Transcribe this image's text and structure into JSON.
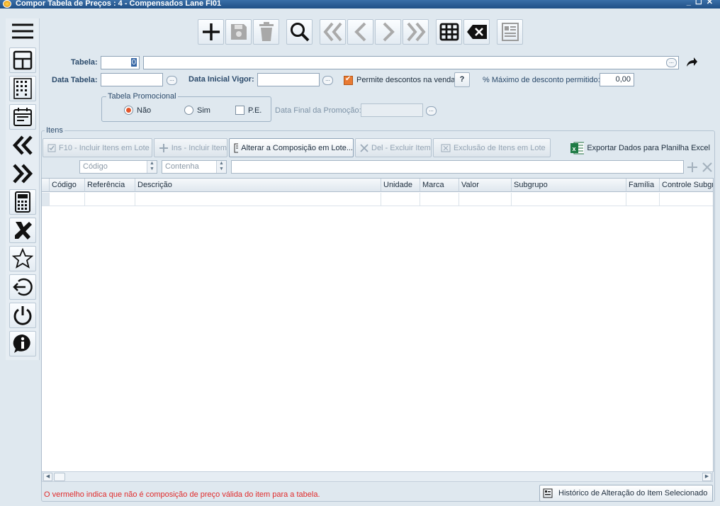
{
  "window": {
    "title": "Compor Tabela de Preços : 4 - Compensados Lane FI01",
    "min": "_",
    "max": "☐",
    "close": "✕"
  },
  "form": {
    "tabela_label": "Tabela:",
    "tabela_value": "0",
    "data_tabela_label": "Data Tabela:",
    "data_inicial_label": "Data Inicial Vigor:",
    "permite_label": "Permite descontos na venda",
    "help_label": "?",
    "max_desc_label": "% Máximo de desconto permitido:",
    "max_desc_value": "0,00",
    "promo_legend": "Tabela Promocional",
    "opt_nao": "Não",
    "opt_sim": "Sim",
    "opt_pe": "P.E.",
    "data_final_label": "Data Final da Promoção:",
    "ell": "..."
  },
  "itens": {
    "legend": "Itens",
    "btn_incluir_lote": "F10 - Incluir Itens em Lote",
    "btn_incluir": "Ins - Incluir Item",
    "btn_alterar": "Alterar a Composição em Lote...",
    "btn_excluir": "Del - Excluir Item",
    "btn_exclusao": "Exclusão de Itens em Lote",
    "btn_exportar": "Exportar Dados para Planilha Excel",
    "filter_field": "Código",
    "filter_op": "Contenha",
    "columns": [
      "Código",
      "Referência",
      "Descrição",
      "Unidade",
      "Marca",
      "Valor",
      "Subgrupo",
      "Família",
      "Controle Subgr"
    ]
  },
  "status": {
    "text": "O vermelho indica que não é composição de preço válida do item para a tabela.",
    "historico": "Histórico de Alteração do Item Selecionado"
  },
  "colors": {
    "accent_red": "#e02b2b",
    "check": "#e87a33"
  }
}
